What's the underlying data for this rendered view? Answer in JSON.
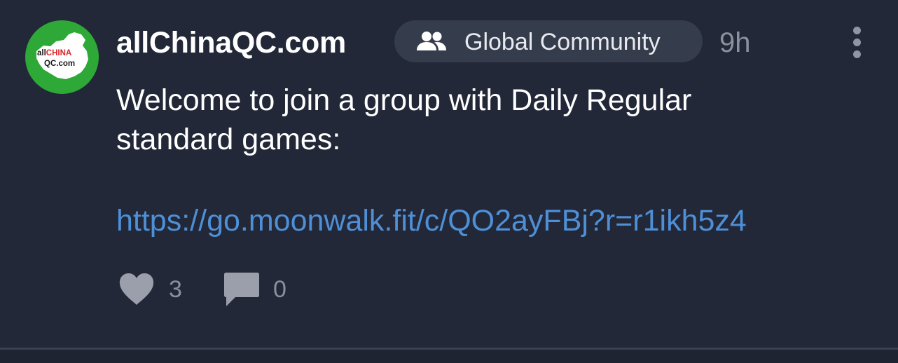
{
  "post": {
    "author": "allChinaQC.com",
    "avatar": {
      "text_line1": "allCHINA",
      "text_line2": "QC.com",
      "bg_color": "#2ea836"
    },
    "community_label": "Global Community",
    "community_icon": "people-icon",
    "time_ago": "9h",
    "body_line1": "Welcome to join a group with Daily Regular",
    "body_line2": "standard games:",
    "link": "https://go.moonwalk.fit/c/QO2ayFBj?r=r1ikh5z4",
    "likes": "3",
    "comments": "0"
  },
  "colors": {
    "background": "#222838",
    "pill_background": "#353c4c",
    "link": "#4e8fd6",
    "muted": "#8a909c",
    "text": "#ffffff"
  },
  "icons": {
    "like": "heart-icon",
    "comment": "comment-icon",
    "more": "more-vertical-icon"
  }
}
